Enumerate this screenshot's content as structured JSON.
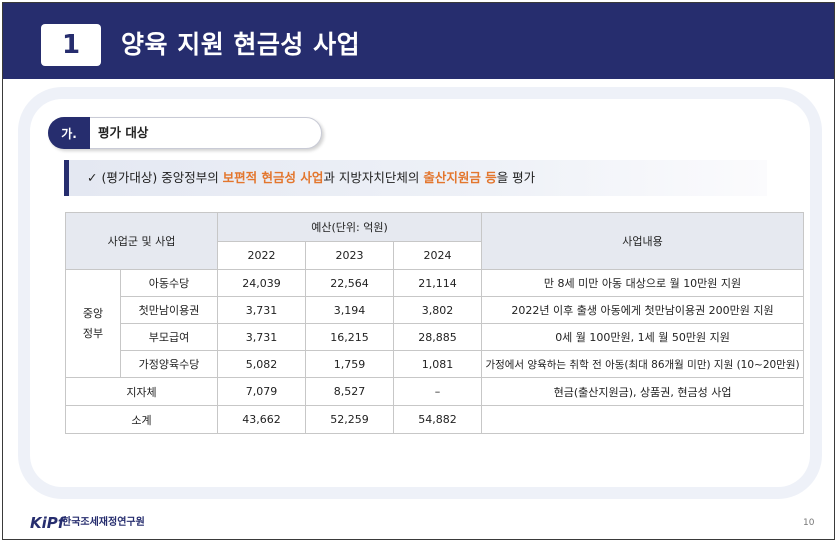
{
  "header": {
    "number": "1",
    "title": "양육 지원 현금성 사업"
  },
  "section": {
    "badge": "가.",
    "title": "평가 대상"
  },
  "bullet": {
    "check": "✓",
    "part1": "(평가대상) 중앙정부의 ",
    "highlight1": "보편적 현금성 사업",
    "part2": "과 지방자치단체의 ",
    "highlight2": "출산지원금 등",
    "part3": "을 평가"
  },
  "table": {
    "headers": {
      "program": "사업군 및 사업",
      "budget": "예산(단위: 억원)",
      "years": [
        "2022",
        "2023",
        "2024"
      ],
      "content": "사업내용"
    },
    "group_label": [
      "중앙",
      "정부"
    ],
    "rows": [
      {
        "name": "아동수당",
        "v2022": "24,039",
        "v2023": "22,564",
        "v2024": "21,114",
        "desc": "만 8세 미만 아동 대상으로 월 10만원 지원"
      },
      {
        "name": "첫만남이용권",
        "v2022": "3,731",
        "v2023": "3,194",
        "v2024": "3,802",
        "desc": "2022년 이후 출생 아동에게 첫만남이용권 200만원 지원"
      },
      {
        "name": "부모급여",
        "v2022": "3,731",
        "v2023": "16,215",
        "v2024": "28,885",
        "desc": "0세 월 100만원, 1세 월 50만원 지원"
      },
      {
        "name": "가정양육수당",
        "v2022": "5,082",
        "v2023": "1,759",
        "v2024": "1,081",
        "desc": "가정에서 양육하는 취학 전 아동(최대 86개월 미만) 지원 (10~20만원)"
      }
    ],
    "local": {
      "name": "지자체",
      "v2022": "7,079",
      "v2023": "8,527",
      "v2024": "–",
      "desc": "현금(출산지원금), 상품권, 현금성 사업"
    },
    "total": {
      "name": "소계",
      "v2022": "43,662",
      "v2023": "52,259",
      "v2024": "54,882",
      "desc": ""
    }
  },
  "footer": {
    "logo": "KiPf",
    "org": "한국조세재정연구원",
    "page": "10"
  },
  "colors": {
    "primary": "#262d6e",
    "accent": "#e3762d",
    "header_cell": "#e6e9f0"
  }
}
